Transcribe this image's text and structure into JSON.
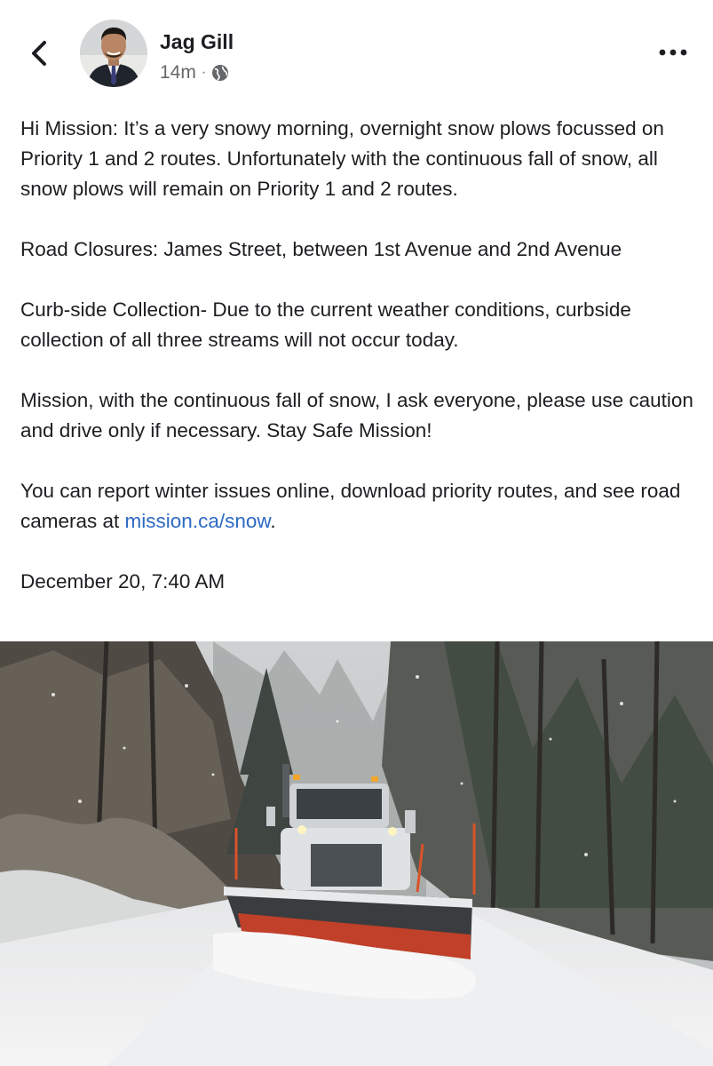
{
  "header": {
    "back_icon": "chevron-left-icon",
    "author_name": "Jag Gill",
    "timestamp": "14m",
    "separator": "·",
    "audience_icon": "globe-icon",
    "more_icon": "more-horizontal-icon"
  },
  "post": {
    "para1": "Hi Mission: It’s a very snowy morning, overnight snow plows focussed on Priority 1 and 2 routes. Unfortunately with the continuous fall of snow, all snow plows will remain on Priority 1 and 2 routes.",
    "para2": "Road Closures: James Street, between 1st Avenue and 2nd Avenue",
    "para3": "Curb-side Collection- Due to the current weather conditions, curbside collection of all three streams will not occur today.",
    "para4": "Mission, with the continuous fall of snow, I ask everyone, please use caution and drive only if necessary. Stay Safe Mission!",
    "para5_before": "You can report winter issues online, download priority routes, and see road cameras at ",
    "para5_link": "mission.ca/snow",
    "para5_after": ".",
    "date": "December 20, 7:40 AM"
  },
  "photo": {
    "icon": "photo-snowplow"
  },
  "colors": {
    "link": "#2d69c3",
    "meta": "#65676b",
    "text": "#1c1e21"
  }
}
